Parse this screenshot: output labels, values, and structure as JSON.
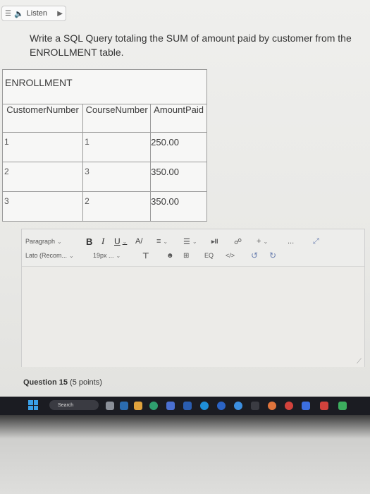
{
  "listen": {
    "label": "Listen"
  },
  "question": {
    "text": "Write a SQL Query totaling the SUM of amount paid by customer from the ENROLLMENT table."
  },
  "table": {
    "title": "ENROLLMENT",
    "columns": [
      "CustomerNumber",
      "CourseNumber",
      "AmountPaid"
    ],
    "rows": [
      [
        "1",
        "1",
        "250.00"
      ],
      [
        "2",
        "3",
        "350.00"
      ],
      [
        "3",
        "2",
        "350.00"
      ]
    ]
  },
  "editor": {
    "paragraph_label": "Paragraph",
    "bold": "B",
    "italic": "I",
    "underline": "U",
    "font_label": "Lato (Recom...",
    "size_label": "19px ...",
    "more_label": "...",
    "code_label": "</>"
  },
  "question_footer": {
    "label": "Question 15",
    "points": "(5 points)"
  },
  "taskbar": {
    "search_label": "Search"
  },
  "colors": {
    "taskbar": "#1b1c22",
    "page": "#efefed"
  }
}
